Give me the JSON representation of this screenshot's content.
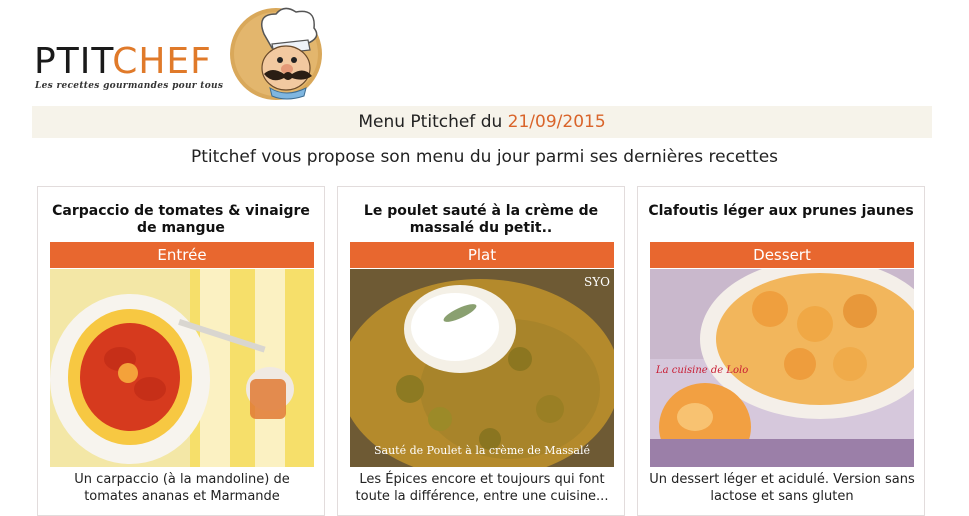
{
  "logo": {
    "part1": "PTIT",
    "part2": "CHEF",
    "tagline": "Les recettes gourmandes pour tous"
  },
  "menu": {
    "label": "Menu Ptitchef du ",
    "date": "21/09/2015"
  },
  "subtitle": "Ptitchef vous propose son menu du jour parmi ses dernières recettes",
  "cards": [
    {
      "title": "Carpaccio de tomates & vinaigre de mangue",
      "category": "Entrée",
      "description": "Un carpaccio (à la mandoline) de tomates ananas et Marmande"
    },
    {
      "title": "Le poulet sauté à la crème de massalé du petit..",
      "category": "Plat",
      "image_watermark": "SYO",
      "image_caption": "Sauté de Poulet à la crème de Massalé",
      "description": "Les Épices encore et toujours qui font toute la différence, entre une cuisine..."
    },
    {
      "title": "Clafoutis léger aux prunes jaunes",
      "category": "Dessert",
      "image_caption": "La cuisine de Lolo",
      "description": "Un dessert léger et acidulé. Version sans lactose et sans gluten"
    }
  ],
  "colors": {
    "accent": "#e8672f",
    "date": "#d9642a",
    "menu_bar_bg": "#f6f3ea"
  }
}
